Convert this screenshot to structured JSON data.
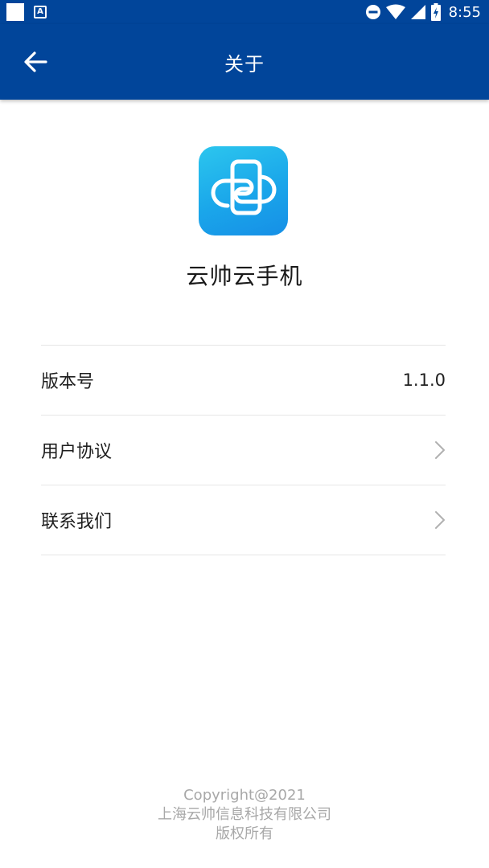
{
  "status_bar": {
    "time": "8:55",
    "notif_app_glyph": "A",
    "icons": [
      "white-square-icon",
      "app-notification-icon",
      "do-not-disturb-icon",
      "wifi-icon",
      "signal-icon",
      "battery-charging-icon"
    ]
  },
  "toolbar": {
    "title": "关于",
    "back_icon": "arrow-left-icon"
  },
  "app": {
    "name": "云帅云手机",
    "logo_icon": "cloud-phone-logo-icon"
  },
  "list": {
    "version": {
      "label": "版本号",
      "value": "1.1.0"
    },
    "agreement": {
      "label": "用户协议"
    },
    "contact": {
      "label": "联系我们"
    }
  },
  "footer": {
    "copyright": "Copyright@2021",
    "company": "上海云帅信息科技有限公司",
    "rights": "版权所有"
  },
  "colors": {
    "header_bg": "#01459a",
    "logo_gradient_start": "#2cc6ee",
    "logo_gradient_end": "#168fe6",
    "divider": "#e6e6e6",
    "footer_text": "#a8a8a8"
  }
}
